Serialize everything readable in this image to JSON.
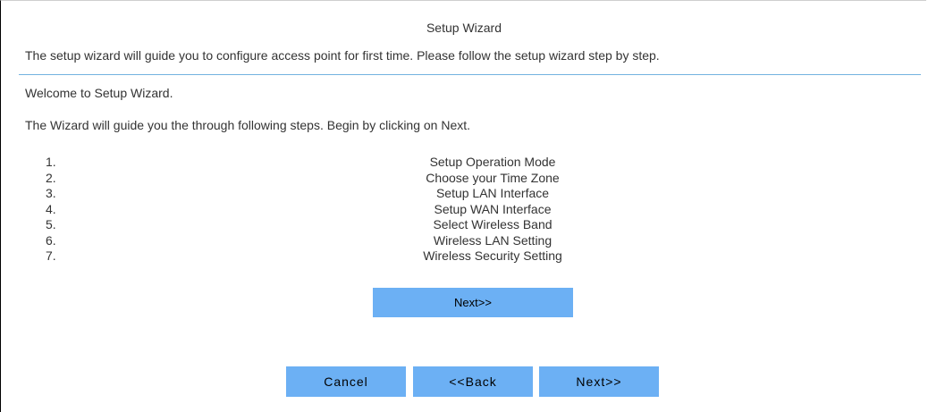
{
  "wizard": {
    "title": "Setup Wizard",
    "intro": "The setup wizard will guide you to configure access point for first time. Please follow the setup wizard step by step.",
    "welcome": "Welcome to Setup Wizard.",
    "guide": "The Wizard will guide you the through following steps. Begin by clicking on Next.",
    "steps": [
      {
        "num": "1.",
        "label": "Setup Operation Mode"
      },
      {
        "num": "2.",
        "label": "Choose your Time Zone"
      },
      {
        "num": "3.",
        "label": "Setup LAN Interface"
      },
      {
        "num": "4.",
        "label": "Setup WAN Interface"
      },
      {
        "num": "5.",
        "label": "Select Wireless Band"
      },
      {
        "num": "6.",
        "label": "Wireless LAN Setting"
      },
      {
        "num": "7.",
        "label": "Wireless Security Setting"
      }
    ],
    "next_top_label": "Next>>"
  },
  "footer": {
    "cancel_label": "Cancel",
    "back_label": "<<Back",
    "next_label": "Next>>"
  },
  "colors": {
    "button_bg": "#6cb0f4",
    "divider": "#73b2e0"
  }
}
